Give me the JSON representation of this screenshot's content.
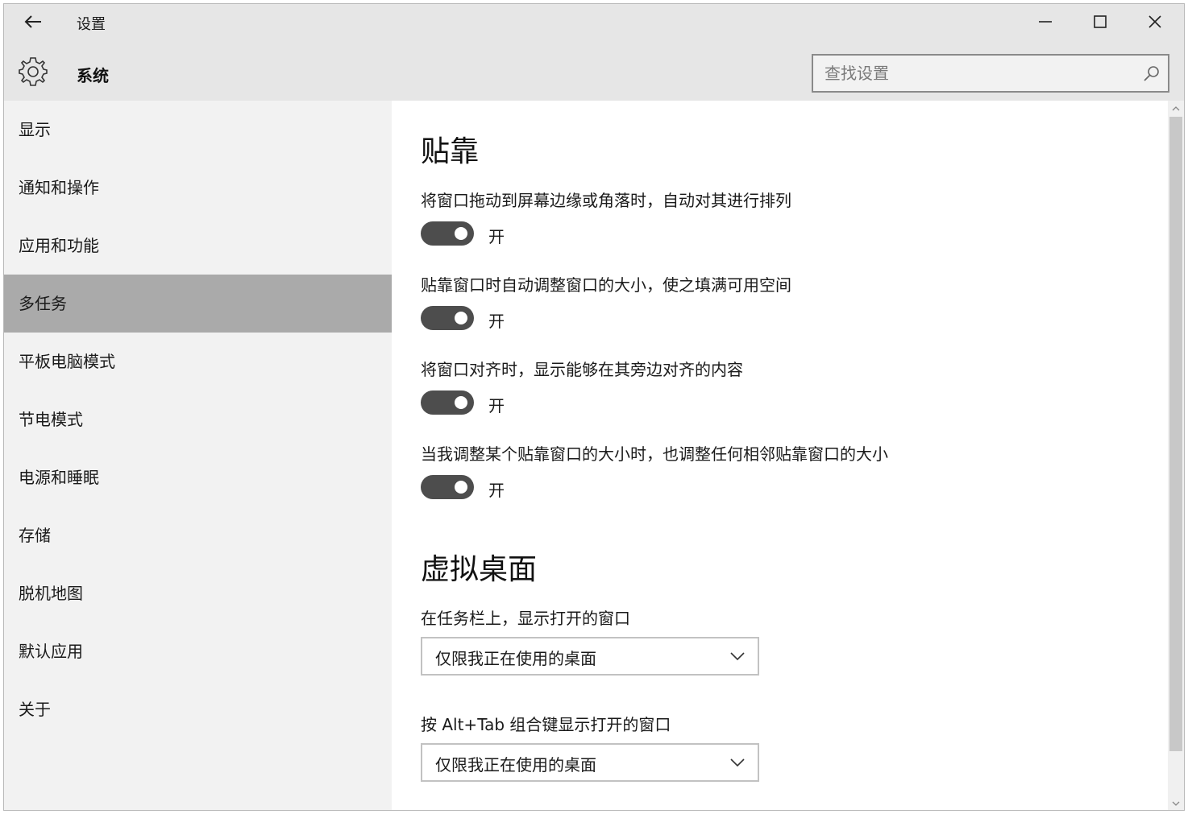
{
  "titlebar": {
    "title": "设置",
    "back_icon": "arrow-left-icon",
    "minimize_icon": "minimize-icon",
    "maximize_icon": "maximize-icon",
    "close_icon": "close-icon"
  },
  "header": {
    "section_title": "系统",
    "section_icon": "gear-icon",
    "search_placeholder": "查找设置",
    "search_icon": "search-icon"
  },
  "sidebar": {
    "items": [
      {
        "label": "显示",
        "selected": false
      },
      {
        "label": "通知和操作",
        "selected": false
      },
      {
        "label": "应用和功能",
        "selected": false
      },
      {
        "label": "多任务",
        "selected": true
      },
      {
        "label": "平板电脑模式",
        "selected": false
      },
      {
        "label": "节电模式",
        "selected": false
      },
      {
        "label": "电源和睡眠",
        "selected": false
      },
      {
        "label": "存储",
        "selected": false
      },
      {
        "label": "脱机地图",
        "selected": false
      },
      {
        "label": "默认应用",
        "selected": false
      },
      {
        "label": "关于",
        "selected": false
      }
    ]
  },
  "snap": {
    "heading": "贴靠",
    "settings": [
      {
        "description": "将窗口拖动到屏幕边缘或角落时，自动对其进行排列",
        "state": "开",
        "on": true
      },
      {
        "description": "贴靠窗口时自动调整窗口的大小，使之填满可用空间",
        "state": "开",
        "on": true
      },
      {
        "description": "将窗口对齐时，显示能够在其旁边对齐的内容",
        "state": "开",
        "on": true
      },
      {
        "description": "当我调整某个贴靠窗口的大小时，也调整任何相邻贴靠窗口的大小",
        "state": "开",
        "on": true
      }
    ]
  },
  "virtual_desktops": {
    "heading": "虚拟桌面",
    "taskbar_label": "在任务栏上，显示打开的窗口",
    "taskbar_value": "仅限我正在使用的桌面",
    "alttab_label": "按 Alt+Tab 组合键显示打开的窗口",
    "alttab_value": "仅限我正在使用的桌面"
  },
  "colors": {
    "chrome_bg": "#e6e6e6",
    "sidebar_bg": "#f2f2f2",
    "selected_bg": "#aaaaaa",
    "toggle_on": "#4d4d4d"
  }
}
